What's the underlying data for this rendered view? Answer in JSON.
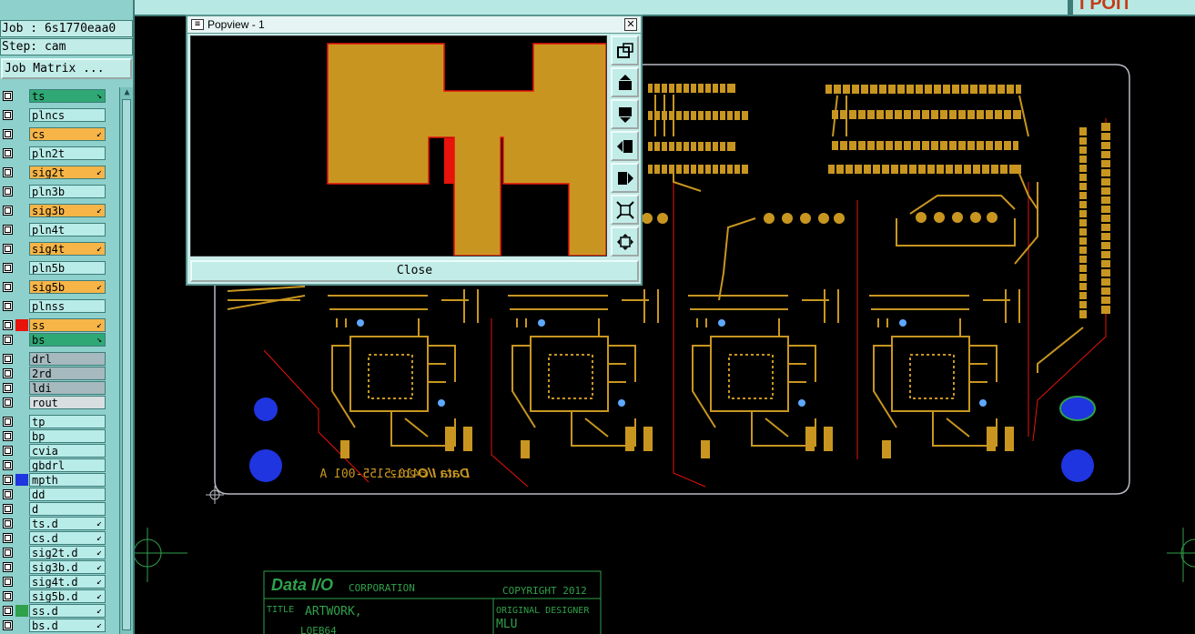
{
  "job_label": "Job : 6s1770eaa0",
  "step_label": "Step: cam",
  "job_matrix_button": "Job Matrix ...",
  "brand_partial": "ГРОП",
  "layers": [
    {
      "name": "ts",
      "kind": "green",
      "arrow": "↘"
    },
    {
      "name": "plncs",
      "kind": "plain",
      "arrow": ""
    },
    {
      "name": "cs",
      "kind": "orange",
      "arrow": "↙"
    },
    {
      "name": "pln2t",
      "kind": "plain",
      "arrow": ""
    },
    {
      "name": "sig2t",
      "kind": "orange",
      "arrow": "↙"
    },
    {
      "name": "pln3b",
      "kind": "plain",
      "arrow": ""
    },
    {
      "name": "sig3b",
      "kind": "orange",
      "arrow": "↙"
    },
    {
      "name": "pln4t",
      "kind": "plain",
      "arrow": ""
    },
    {
      "name": "sig4t",
      "kind": "orange",
      "arrow": "↙"
    },
    {
      "name": "pln5b",
      "kind": "plain",
      "arrow": ""
    },
    {
      "name": "sig5b",
      "kind": "orange",
      "arrow": "↙"
    },
    {
      "name": "plnss",
      "kind": "plain",
      "arrow": ""
    },
    {
      "name": "ss",
      "kind": "orange",
      "arrow": "↙",
      "swatch": "#e8130b"
    },
    {
      "name": "bs",
      "kind": "green",
      "arrow": "↘"
    },
    {
      "name": "drl",
      "kind": "grey",
      "arrow": ""
    },
    {
      "name": "2rd",
      "kind": "grey",
      "arrow": ""
    },
    {
      "name": "ldi",
      "kind": "grey",
      "arrow": ""
    },
    {
      "name": "rout",
      "kind": "light",
      "arrow": ""
    },
    {
      "name": "tp",
      "kind": "plain",
      "arrow": ""
    },
    {
      "name": "bp",
      "kind": "plain",
      "arrow": ""
    },
    {
      "name": "cvia",
      "kind": "plain",
      "arrow": ""
    },
    {
      "name": "gbdrl",
      "kind": "plain",
      "arrow": ""
    },
    {
      "name": "mpth",
      "kind": "plain",
      "arrow": "",
      "swatch": "#1f35e0"
    },
    {
      "name": "dd",
      "kind": "plain",
      "arrow": ""
    },
    {
      "name": "d",
      "kind": "plain",
      "arrow": ""
    },
    {
      "name": "ts.d",
      "kind": "plain",
      "arrow": "↙"
    },
    {
      "name": "cs.d",
      "kind": "plain",
      "arrow": "↙"
    },
    {
      "name": "sig2t.d",
      "kind": "plain",
      "arrow": "↙"
    },
    {
      "name": "sig3b.d",
      "kind": "plain",
      "arrow": "↙"
    },
    {
      "name": "sig4t.d",
      "kind": "plain",
      "arrow": "↙"
    },
    {
      "name": "sig5b.d",
      "kind": "plain",
      "arrow": "↙"
    },
    {
      "name": "ss.d",
      "kind": "plain",
      "arrow": "↙",
      "swatch": "#2fa14a"
    },
    {
      "name": "bs.d",
      "kind": "plain",
      "arrow": "↙"
    }
  ],
  "popview": {
    "title": "Popview - 1",
    "close_label": "Close",
    "tool_icons": [
      "zoom-window-icon",
      "pan-up-icon",
      "pan-down-icon",
      "pan-left-icon",
      "pan-right-icon",
      "zoom-out-icon",
      "zoom-in-icon"
    ]
  },
  "board": {
    "part_number": "410-5155-001 A",
    "copyright_mark": "© 2012",
    "brand": "Data I/O"
  },
  "title_block": {
    "brand": "Data I/O",
    "corporation": "CORPORATION",
    "copyright": "COPYRIGHT  2012",
    "title_label": "TITLE",
    "title_value": "ARTWORK,",
    "title_value_2": "LOEB64",
    "designer_label": "ORIGINAL DESIGNER",
    "designer_value": "MLU"
  },
  "colors": {
    "trace": "#c89620",
    "outline": "#b8bbc4",
    "pad_blue": "#1f35e0",
    "red": "#e8130b",
    "green": "#2fa14a"
  }
}
